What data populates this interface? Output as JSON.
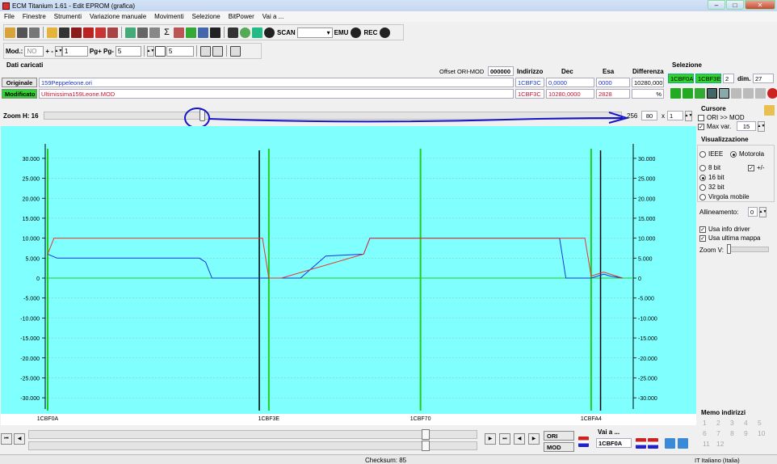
{
  "window": {
    "title": "ECM Titanium 1.61 - Edit EPROM (grafica)",
    "min": "–",
    "max": "□",
    "close": "✕"
  },
  "menu": [
    "File",
    "Finestre",
    "Strumenti",
    "Variazione manuale",
    "Movimenti",
    "Selezione",
    "BitPower",
    "Vai a ..."
  ],
  "toolbar": {
    "scan_label": "SCAN",
    "emu_label": "EMU",
    "rec_label": "REC",
    "sigma": "Σ"
  },
  "toolbar2": {
    "mod_label": "Mod.:",
    "mod_value": "NO",
    "step_label": "+ -",
    "step_value": "1",
    "pg_label": "Pg+ Pg-",
    "pg_value": "5",
    "tp_value": "5"
  },
  "data_panel": {
    "title": "Dati caricati",
    "offset_label": "Offset ORI-MOD",
    "offset_value": "000000",
    "col_indirizzo": "Indirizzo",
    "col_dec": "Dec",
    "col_esa": "Esa",
    "col_diff": "Differenza",
    "orig_label": "Originale",
    "orig_file": "159Peppeleone.ori",
    "orig_addr": "1CBF3C",
    "orig_dec": "0,0000",
    "orig_esa": "0000",
    "diff_value": "10280,000",
    "mod_label": "Modificato",
    "mod_file": "Ultimissima159Leone.MOD",
    "mod_addr": "1CBF3C",
    "mod_dec": "10280,0000",
    "mod_esa": "2828",
    "percent": "%"
  },
  "selezione": {
    "title": "Selezione",
    "start": "1CBF0A",
    "end": "1CBF3E",
    "num": "2",
    "dim_label": "dim.",
    "dim_value": "27"
  },
  "zoom": {
    "label": "Zoom H: 16",
    "v1": "256",
    "v2": "80",
    "x_label": "x",
    "v3": "1",
    "slider_pos": 0.27
  },
  "cursore": {
    "title": "Cursore",
    "ori_mod": "ORI >> MOD",
    "max_var": "Max var.",
    "max_var_value": "15"
  },
  "visualizzazione": {
    "title": "Visualizzazione",
    "ieee": "IEEE",
    "motorola": "Motorola",
    "bit8": "8 bit",
    "bit16": "16 bit",
    "bit32": "32 bit",
    "virgola": "Virgola mobile",
    "plusminus": "+/-",
    "allineamento": "Allineamento:",
    "allineamento_value": "0",
    "usa_info": "Usa info driver",
    "usa_ultima": "Usa ultima mappa",
    "zoom_v": "Zoom V:"
  },
  "memo": {
    "title": "Memo indirizzi",
    "nums": [
      "1",
      "2",
      "3",
      "4",
      "5",
      "6",
      "7",
      "8",
      "9",
      "10",
      "11",
      "12"
    ]
  },
  "vai_a": {
    "label": "Vai a ...",
    "value": "1CBF0A"
  },
  "buttons": {
    "ori": "ORI",
    "mod": "MOD"
  },
  "status": {
    "checksum": "Checksum: 85",
    "lang": "IT Italiano (Italia)"
  },
  "colors": {
    "chart_bg": "#80ffff",
    "ori_line": "#1a33e6",
    "mod_line": "#e6332a",
    "marker_green": "#1fcf1f",
    "cursor_black": "#000000"
  },
  "chart_data": {
    "type": "line",
    "ylim": [
      -32000,
      32000
    ],
    "yticks": [
      "30.000",
      "25.000",
      "20.000",
      "15.000",
      "10.000",
      "5.000",
      "0",
      "-5.000",
      "-10.000",
      "-15.000",
      "-20.000",
      "-25.000",
      "-30.000"
    ],
    "xlabels": [
      "1CBF0A",
      "1CBF3E",
      "1CBF70",
      "1CBFA4"
    ],
    "grid": true,
    "series": [
      {
        "key": "ori",
        "values": [
          [
            0,
            6000
          ],
          [
            1,
            5000
          ],
          [
            2,
            5000
          ],
          [
            3,
            5000
          ],
          [
            4,
            5000
          ],
          [
            5,
            5000
          ],
          [
            6,
            5000
          ],
          [
            7,
            5000
          ],
          [
            8,
            5000
          ],
          [
            9,
            5000
          ],
          [
            10,
            5000
          ],
          [
            11,
            5000
          ],
          [
            12,
            5000
          ],
          [
            13,
            5000
          ],
          [
            14,
            5000
          ],
          [
            15,
            5000
          ],
          [
            16,
            5000
          ],
          [
            17,
            5000
          ],
          [
            18,
            5000
          ],
          [
            19,
            5000
          ],
          [
            20,
            5000
          ],
          [
            21,
            4000
          ],
          [
            22,
            0
          ],
          [
            23,
            0
          ],
          [
            24,
            0
          ],
          [
            25,
            0
          ],
          [
            26,
            0
          ],
          [
            27,
            0
          ],
          [
            28,
            0
          ],
          [
            29,
            0
          ],
          [
            30,
            0
          ],
          [
            31,
            0
          ],
          [
            32,
            0
          ],
          [
            33,
            0
          ],
          [
            34,
            0
          ],
          [
            35,
            0
          ],
          [
            36,
            0
          ],
          [
            37,
            0
          ],
          [
            38,
            0
          ],
          [
            39,
            0
          ],
          [
            40,
            0
          ],
          [
            41,
            0
          ],
          [
            42,
            0
          ],
          [
            43,
            0
          ],
          [
            44,
            0
          ],
          [
            45,
            0
          ],
          [
            46,
            0
          ],
          [
            47,
            0
          ],
          [
            48,
            0
          ],
          [
            49,
            0
          ],
          [
            50,
            0
          ],
          [
            51,
            0
          ],
          [
            52,
            0
          ],
          [
            53,
            0
          ],
          [
            54,
            0
          ],
          [
            55,
            0
          ],
          [
            56,
            0
          ],
          [
            57,
            0
          ],
          [
            58,
            0
          ],
          [
            59,
            0
          ],
          [
            60,
            0
          ],
          [
            61,
            0
          ],
          [
            62,
            0
          ],
          [
            63,
            0
          ],
          [
            64,
            0
          ],
          [
            65,
            0
          ],
          [
            66,
            0
          ],
          [
            67,
            0
          ],
          [
            68,
            0
          ],
          [
            69,
            0
          ],
          [
            70,
            0
          ],
          [
            71,
            0
          ],
          [
            72,
            0
          ],
          [
            73,
            0
          ],
          [
            74,
            0
          ],
          [
            75,
            0
          ],
          [
            76,
            0
          ],
          [
            77,
            0
          ],
          [
            78,
            0
          ],
          [
            79,
            0
          ],
          [
            80,
            0
          ],
          [
            81,
            0
          ],
          [
            82,
            0
          ],
          [
            83,
            0
          ],
          [
            84,
            0
          ],
          [
            85,
            0
          ],
          [
            86,
            0
          ],
          [
            87,
            0
          ],
          [
            88,
            0
          ],
          [
            89,
            0
          ],
          [
            90,
            0
          ],
          [
            91,
            0
          ],
          [
            92,
            0
          ],
          [
            93,
            0
          ],
          [
            94,
            0
          ],
          [
            95,
            0
          ],
          [
            96,
            0
          ],
          [
            97,
            0
          ],
          [
            98,
            0
          ],
          [
            99,
            0
          ],
          [
            100,
            6000
          ],
          [
            101,
            10000
          ],
          [
            102,
            10000
          ],
          [
            103,
            10000
          ],
          [
            104,
            10000
          ],
          [
            105,
            10000
          ],
          [
            106,
            10000
          ],
          [
            107,
            10000
          ],
          [
            108,
            10000
          ],
          [
            109,
            10000
          ],
          [
            110,
            10000
          ],
          [
            111,
            10000
          ],
          [
            112,
            10000
          ],
          [
            113,
            10000
          ],
          [
            114,
            10000
          ],
          [
            115,
            10000
          ],
          [
            116,
            10000
          ],
          [
            117,
            10000
          ],
          [
            118,
            10000
          ],
          [
            119,
            10000
          ],
          [
            120,
            10000
          ],
          [
            121,
            10000
          ],
          [
            122,
            10000
          ],
          [
            123,
            10000
          ],
          [
            124,
            10000
          ],
          [
            125,
            10000
          ],
          [
            126,
            10000
          ],
          [
            127,
            10000
          ],
          [
            128,
            10000
          ],
          [
            129,
            10000
          ],
          [
            130,
            10000
          ],
          [
            131,
            10000
          ],
          [
            132,
            10000
          ],
          [
            133,
            10000
          ],
          [
            134,
            10000
          ],
          [
            135,
            10000
          ],
          [
            136,
            10000
          ],
          [
            137,
            10000
          ],
          [
            138,
            10000
          ],
          [
            139,
            10000
          ],
          [
            140,
            10000
          ],
          [
            141,
            10000
          ],
          [
            142,
            10000
          ],
          [
            143,
            10000
          ],
          [
            144,
            10000
          ],
          [
            145,
            10000
          ],
          [
            146,
            10000
          ],
          [
            147,
            10000
          ],
          [
            148,
            10000
          ],
          [
            149,
            10000
          ],
          [
            150,
            10000
          ],
          [
            151,
            10000
          ],
          [
            152,
            10000
          ],
          [
            153,
            10000
          ],
          [
            154,
            10000
          ],
          [
            155,
            10000
          ],
          [
            156,
            10000
          ],
          [
            157,
            10000
          ],
          [
            158,
            10000
          ],
          [
            159,
            10000
          ],
          [
            160,
            10000
          ],
          [
            161,
            10000
          ],
          [
            162,
            10000
          ],
          [
            163,
            10000
          ],
          [
            164,
            10000
          ],
          [
            165,
            10000
          ],
          [
            166,
            10000
          ],
          [
            167,
            10000
          ],
          [
            168,
            10000
          ],
          [
            169,
            10000
          ],
          [
            170,
            10000
          ],
          [
            171,
            10000
          ],
          [
            172,
            10000
          ],
          [
            173,
            10000
          ],
          [
            174,
            10000
          ],
          [
            175,
            10000
          ],
          [
            176,
            10000
          ],
          [
            177,
            10000
          ],
          [
            178,
            10000
          ],
          [
            179,
            10000
          ],
          [
            180,
            10000
          ],
          [
            181,
            10000
          ],
          [
            182,
            10000
          ],
          [
            183,
            10000
          ],
          [
            184,
            10000
          ],
          [
            185,
            10000
          ],
          [
            186,
            10000
          ],
          [
            187,
            10000
          ],
          [
            188,
            10000
          ],
          [
            189,
            10000
          ],
          [
            190,
            10000
          ],
          [
            191,
            10000
          ],
          [
            192,
            10000
          ],
          [
            193,
            10000
          ],
          [
            194,
            10000
          ],
          [
            195,
            10000
          ],
          [
            196,
            10000
          ],
          [
            197,
            10000
          ],
          [
            198,
            10000
          ],
          [
            199,
            10000
          ],
          [
            200,
            10000
          ],
          [
            201,
            10000
          ],
          [
            202,
            10000
          ],
          [
            203,
            10000
          ],
          [
            204,
            10000
          ],
          [
            205,
            10000
          ],
          [
            206,
            10000
          ],
          [
            207,
            10000
          ],
          [
            208,
            10000
          ],
          [
            209,
            10000
          ],
          [
            210,
            10000
          ],
          [
            211,
            10000
          ],
          [
            212,
            10000
          ],
          [
            213,
            10000
          ],
          [
            214,
            10000
          ],
          [
            215,
            10000
          ],
          [
            216,
            10000
          ],
          [
            217,
            10000
          ],
          [
            218,
            10000
          ],
          [
            219,
            10000
          ],
          [
            220,
            10000
          ],
          [
            221,
            10000
          ],
          [
            222,
            10000
          ],
          [
            223,
            10000
          ],
          [
            224,
            10000
          ],
          [
            225,
            10000
          ],
          [
            226,
            10000
          ],
          [
            227,
            10000
          ],
          [
            228,
            10000
          ],
          [
            229,
            10000
          ],
          [
            230,
            10000
          ],
          [
            231,
            10000
          ],
          [
            232,
            10000
          ],
          [
            233,
            10000
          ],
          [
            234,
            10000
          ],
          [
            235,
            10000
          ],
          [
            236,
            10000
          ],
          [
            237,
            10000
          ],
          [
            238,
            10000
          ],
          [
            239,
            10000
          ],
          [
            240,
            10000
          ],
          [
            241,
            10000
          ],
          [
            242,
            10000
          ],
          [
            243,
            10000
          ],
          [
            244,
            10000
          ],
          [
            245,
            10000
          ],
          [
            246,
            10000
          ],
          [
            247,
            10000
          ],
          [
            248,
            10000
          ],
          [
            249,
            10000
          ],
          [
            250,
            10000
          ],
          [
            251,
            10000
          ],
          [
            252,
            10000
          ],
          [
            253,
            10000
          ],
          [
            254,
            10000
          ],
          [
            255,
            10000
          ]
        ]
      },
      {
        "key": "mod",
        "values": []
      }
    ],
    "ori_points": [
      [
        0,
        6000
      ],
      [
        1.5,
        5000
      ],
      [
        24,
        5000
      ],
      [
        25,
        4000
      ],
      [
        26,
        0
      ],
      [
        37,
        0
      ],
      [
        40,
        0
      ],
      [
        44,
        5500
      ],
      [
        50,
        6000
      ],
      [
        51,
        10000
      ],
      [
        81,
        10000
      ],
      [
        82,
        0
      ],
      [
        86,
        0
      ],
      [
        88,
        1000
      ],
      [
        89,
        500
      ],
      [
        91,
        0
      ]
    ],
    "mod_points": [
      [
        0,
        6000
      ],
      [
        1,
        10000
      ],
      [
        34,
        10000
      ],
      [
        35,
        0
      ],
      [
        37,
        0
      ],
      [
        50,
        6000
      ],
      [
        51,
        10000
      ],
      [
        85,
        10000
      ],
      [
        86,
        500
      ],
      [
        88,
        1500
      ],
      [
        91,
        0
      ]
    ],
    "cursors_black": [
      34,
      88
    ],
    "markers_green": [
      0,
      35,
      59,
      86
    ],
    "x_max": 91
  }
}
